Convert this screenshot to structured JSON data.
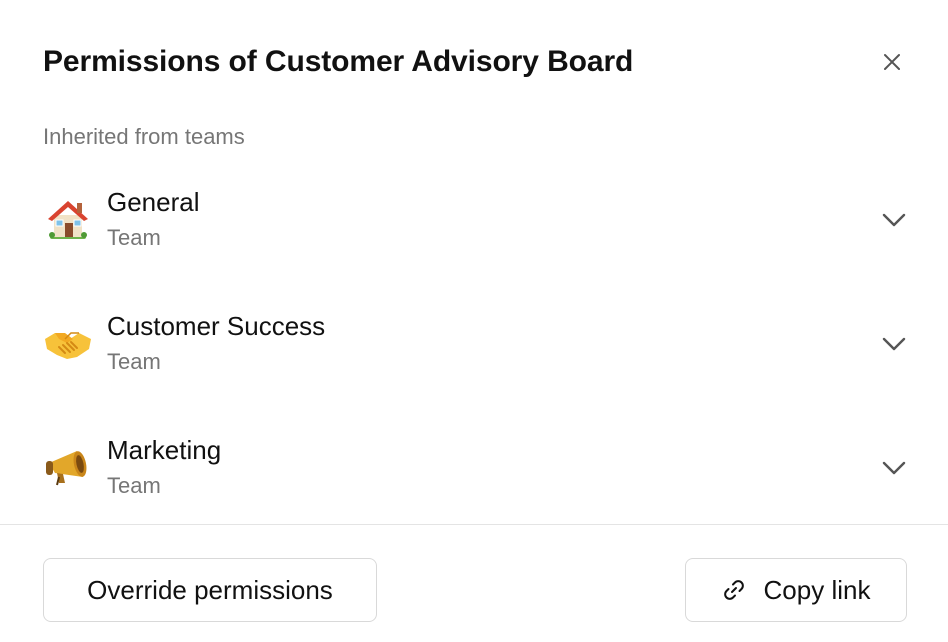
{
  "dialog": {
    "title": "Permissions of Customer Advisory Board",
    "close_icon": "close-icon"
  },
  "section": {
    "label": "Inherited from teams"
  },
  "teams": [
    {
      "name": "General",
      "type": "Team",
      "icon": "house-emoji"
    },
    {
      "name": "Customer Success",
      "type": "Team",
      "icon": "handshake-emoji"
    },
    {
      "name": "Marketing",
      "type": "Team",
      "icon": "megaphone-emoji"
    }
  ],
  "footer": {
    "override_label": "Override permissions",
    "copy_link_label": "Copy link",
    "copy_link_icon": "link-icon"
  },
  "colors": {
    "text_primary": "#111111",
    "text_secondary": "#767676",
    "border": "#d9d9d9",
    "divider": "#e4e4e4",
    "background": "#ffffff"
  }
}
